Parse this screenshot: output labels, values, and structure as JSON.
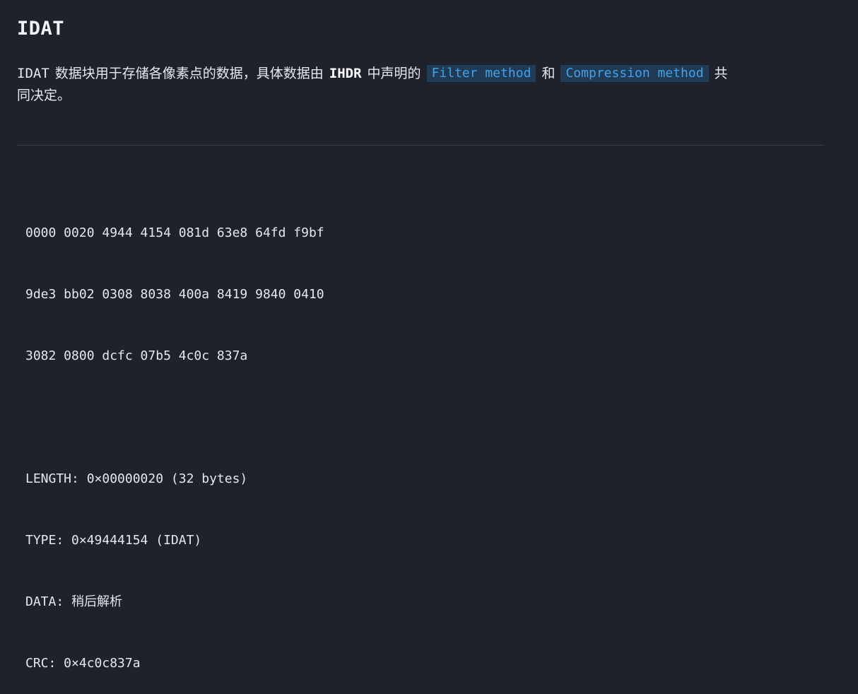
{
  "heading": "IDAT",
  "paragraph": {
    "prefix": "IDAT",
    "text_a": "数据块用于存储各像素点的数据，具体数据由",
    "bold": "IHDR",
    "text_b": "中声明的",
    "code_1": "Filter method",
    "conj": "和",
    "code_2": "Compression method",
    "text_c": "共",
    "line2": "同决定。"
  },
  "code_block": {
    "hex_lines": [
      "0000 0020 4944 4154 081d 63e8 64fd f9bf",
      "9de3 bb02 0308 8038 400a 8419 9840 0410",
      "3082 0800 dcfc 07b5 4c0c 837a"
    ],
    "fields": [
      "LENGTH: 0×00000020 (32 bytes)",
      "TYPE: 0×49444154 (IDAT)",
      "DATA: 稍后解析",
      "CRC: 0×4c0c837a"
    ]
  },
  "colors": {
    "background": "#1e222d",
    "text": "#e6e8ee",
    "inline_code_bg": "#213b55",
    "inline_code_fg": "#3fa3ec",
    "divider": "#353a47"
  }
}
